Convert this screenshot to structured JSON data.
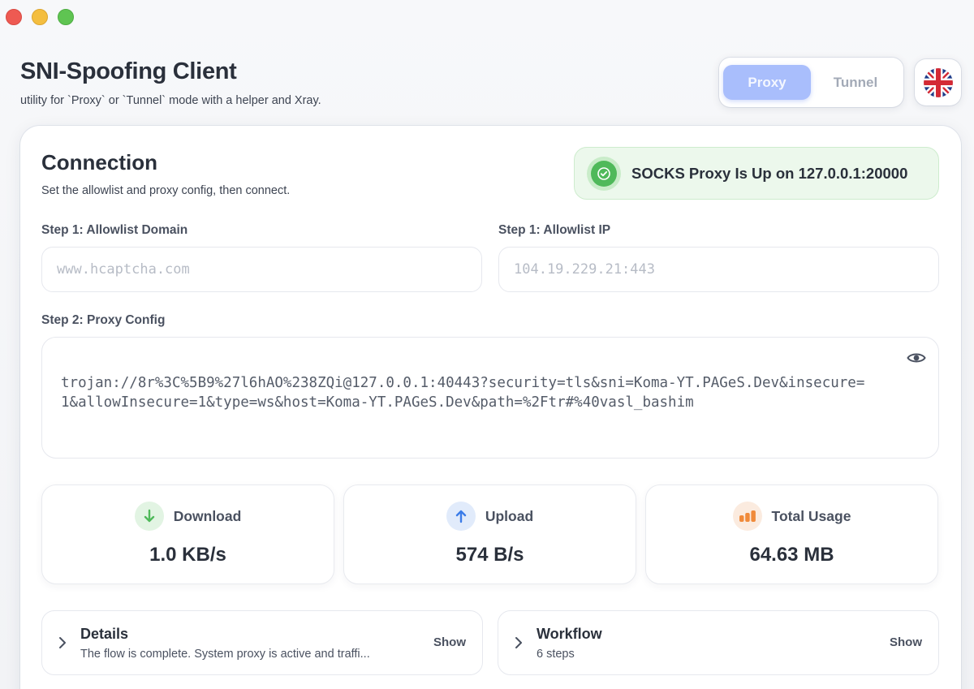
{
  "app": {
    "title": "SNI-Spoofing Client",
    "subtitle": "utility for `Proxy` or `Tunnel` mode with a helper and Xray."
  },
  "mode_switch": {
    "options": [
      "Proxy",
      "Tunnel"
    ],
    "selected": "Proxy"
  },
  "language": {
    "icon": "uk-flag-icon"
  },
  "connection": {
    "title": "Connection",
    "subtitle": "Set the allowlist and proxy config, then connect.",
    "status": {
      "text": "SOCKS Proxy Is Up on 127.0.0.1:20000",
      "color": "#4fb95a"
    },
    "allowlist_domain": {
      "label": "Step 1: Allowlist Domain",
      "placeholder": "www.hcaptcha.com"
    },
    "allowlist_ip": {
      "label": "Step 1: Allowlist IP",
      "placeholder": "104.19.229.21:443"
    },
    "proxy_config": {
      "label": "Step 2: Proxy Config",
      "value": "trojan://8r%3C%5B9%27l6hAO%238ZQi@127.0.0.1:40443?security=tls&sni=Koma-YT.PAGeS.Dev&insecure=1&allowInsecure=1&type=ws&host=Koma-YT.PAGeS.Dev&path=%2Ftr#%40vasl_bashim"
    }
  },
  "stats": {
    "download": {
      "label": "Download",
      "value": "1.0 KB/s",
      "color": "#4fb95a"
    },
    "upload": {
      "label": "Upload",
      "value": "574 B/s",
      "color": "#3b7ce8"
    },
    "total": {
      "label": "Total Usage",
      "value": "64.63 MB",
      "color": "#f08a3a"
    }
  },
  "details": {
    "title": "Details",
    "subtitle": "The flow is complete. System proxy is active and traffi...",
    "action": "Show"
  },
  "workflow": {
    "title": "Workflow",
    "subtitle": "6 steps",
    "action": "Show"
  }
}
